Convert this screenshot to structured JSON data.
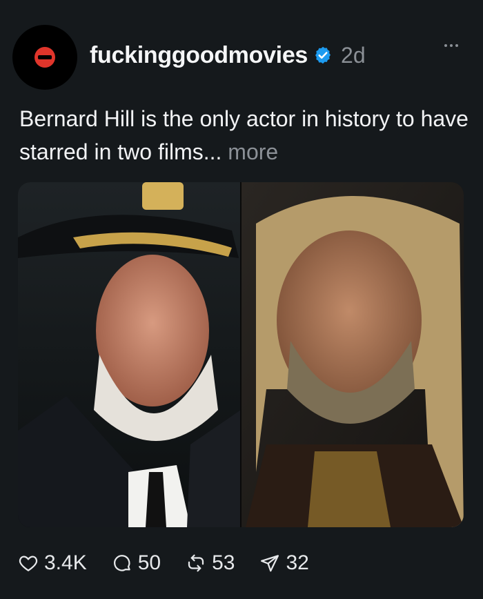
{
  "post": {
    "username": "fuckinggoodmovies",
    "time": "2d",
    "caption_text": "Bernard Hill is the only actor in history to have starred in two films...",
    "more_label": "more",
    "media_description_icon": "photo",
    "actions": {
      "likes": "3.4K",
      "comments": "50",
      "reposts": "53",
      "shares": "32"
    }
  },
  "colors": {
    "background": "#15191c",
    "verified": "#1d9bf0",
    "muted": "#8b9096",
    "avatar_mark": "#e0352b"
  }
}
